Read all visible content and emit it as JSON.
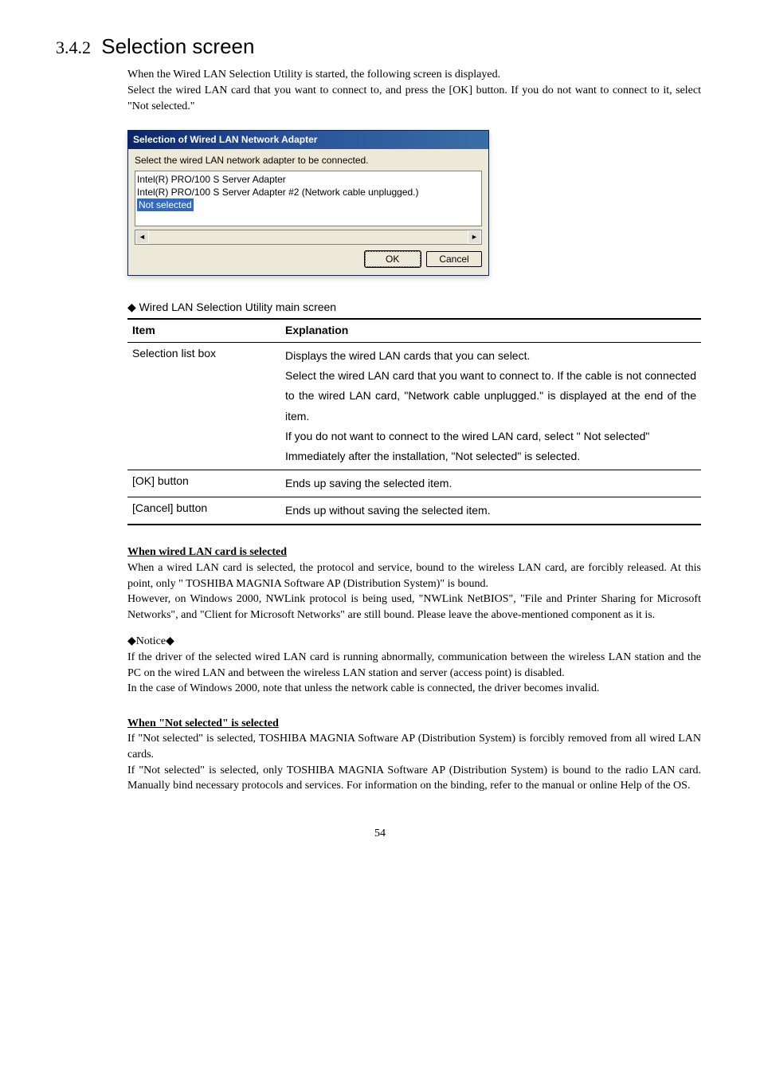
{
  "heading_number": "3.4.2",
  "heading_title": "Selection screen",
  "intro_p1": "When the Wired LAN Selection Utility is started, the following screen is displayed.",
  "intro_p2": "Select the wired LAN card that you want to connect to, and press the [OK] button.  If you do not want to connect to it, select \"Not selected.\"",
  "dialog": {
    "title": "Selection of Wired LAN Network Adapter",
    "instruction": "Select the wired LAN network adapter to be connected.",
    "items": [
      "Intel(R) PRO/100 S Server Adapter",
      "Intel(R) PRO/100 S Server Adapter #2 (Network cable unplugged.)",
      "Not selected"
    ],
    "ok_label": "OK",
    "cancel_label": "Cancel"
  },
  "table_caption_prefix": "◆",
  "table_caption": "Wired LAN Selection Utility main screen",
  "table": {
    "col_item": "Item",
    "col_exp": "Explanation",
    "rows": [
      {
        "item": "Selection list box",
        "expl": "Displays the wired LAN cards that you can select.\nSelect the wired LAN card that you want to connect to. If the cable is not connected to the wired LAN card, \"Network cable unplugged.\" is displayed at the end of the item.\nIf you do not want to connect to the wired LAN card, select \" Not selected\"\nImmediately after the installation, \"Not selected\" is selected."
      },
      {
        "item": "[OK] button",
        "expl": "Ends up saving the selected item."
      },
      {
        "item": "[Cancel] button",
        "expl": "Ends up without saving the selected item."
      }
    ]
  },
  "sec1_title": "When wired LAN card is selected",
  "sec1_p1": "When a wired LAN card is selected, the protocol and service, bound to the wireless LAN card, are forcibly released.  At this point, only \" TOSHIBA MAGNIA Software AP (Distribution System)\" is bound.",
  "sec1_p2": "However, on Windows 2000, NWLink protocol is being used, \"NWLink NetBIOS\", \"File and Printer Sharing for Microsoft Networks\", and \"Client for Microsoft Networks\" are still bound.  Please leave the above-mentioned component as it is.",
  "notice_label": "◆Notice◆",
  "notice_p1": "If the driver of the selected wired LAN card is running abnormally, communication between the wireless LAN station and the PC on the wired LAN and between the wireless LAN station and server (access point) is disabled.",
  "notice_p2": "In the case of Windows 2000, note that unless the network cable is connected, the driver becomes invalid.",
  "sec2_title": "When \"Not selected\" is selected",
  "sec2_p1": "If \"Not selected\" is selected, TOSHIBA MAGNIA Software AP (Distribution System) is forcibly removed from all wired LAN cards.",
  "sec2_p2": "If \"Not selected\" is selected, only TOSHIBA MAGNIA Software AP (Distribution System) is bound to the radio LAN card.  Manually bind necessary protocols and services.  For information on the binding, refer to the manual or online Help of the OS.",
  "page_number": "54"
}
